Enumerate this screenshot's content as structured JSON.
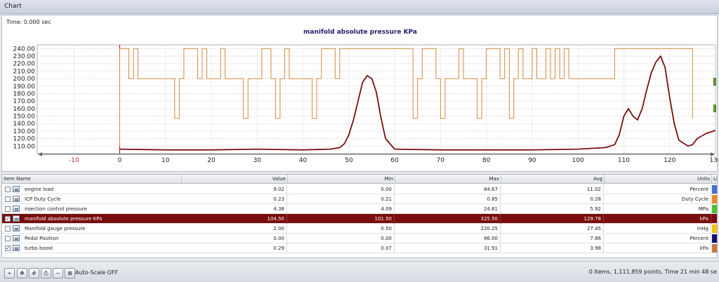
{
  "window": {
    "title": "Chart"
  },
  "chart": {
    "time_label": "Time: 0.000 sec",
    "title": "manifold absolute pressure KPa"
  },
  "chart_data": {
    "type": "line",
    "title": "manifold absolute pressure KPa",
    "xlabel": "",
    "ylabel": "",
    "xlim": [
      -18,
      130
    ],
    "ylim": [
      100,
      245
    ],
    "x_ticks": [
      -10,
      0,
      10,
      20,
      30,
      40,
      50,
      60,
      70,
      80,
      90,
      100,
      110,
      120,
      130
    ],
    "y_ticks": [
      110,
      120,
      130,
      140,
      150,
      160,
      170,
      180,
      190,
      200,
      210,
      220,
      230,
      240
    ],
    "y_tick_labels": [
      "110.00",
      "120.00",
      "130.00",
      "140.00",
      "150.00",
      "160.00",
      "170.00",
      "180.00",
      "190.00",
      "200.00",
      "210.00",
      "220.00",
      "230.00",
      "240.00"
    ],
    "grid": true,
    "series": [
      {
        "name": "manifold absolute pressure KPa",
        "color": "#7a1010",
        "x": [
          0,
          10,
          20,
          30,
          40,
          46,
          48,
          49,
          50,
          51,
          52,
          53,
          54,
          55,
          56,
          57,
          58,
          60,
          70,
          80,
          90,
          100,
          106,
          108,
          109,
          110,
          111,
          112,
          113,
          114,
          115,
          116,
          117,
          118,
          119,
          120,
          121,
          122,
          124,
          125,
          126,
          128,
          130
        ],
        "y": [
          106,
          105,
          105,
          106,
          105,
          106,
          108,
          113,
          125,
          145,
          170,
          195,
          204,
          200,
          182,
          148,
          120,
          106,
          105,
          105,
          105,
          106,
          108,
          112,
          125,
          150,
          160,
          150,
          145,
          160,
          185,
          208,
          222,
          230,
          215,
          175,
          140,
          118,
          110,
          112,
          120,
          127,
          131
        ]
      },
      {
        "name": "turbo boost",
        "color": "#d08a3c",
        "x": [
          0,
          0,
          2,
          2,
          3,
          3,
          4,
          4,
          12,
          12,
          13,
          13,
          14,
          14,
          17,
          17,
          18,
          18,
          19,
          19,
          22,
          22,
          23,
          23,
          27,
          27,
          28,
          28,
          31,
          31,
          33,
          33,
          34,
          34,
          35,
          35,
          36,
          36,
          37,
          37,
          42,
          42,
          43,
          43,
          44,
          44,
          47,
          47,
          48,
          48,
          64,
          64,
          65,
          65,
          66,
          66,
          69,
          69,
          70,
          70,
          71,
          71,
          74,
          74,
          75,
          75,
          78,
          78,
          79,
          79,
          80,
          80,
          83,
          83,
          84,
          84,
          85,
          85,
          86,
          86,
          87,
          87,
          88,
          88,
          90,
          90,
          91,
          91,
          93,
          93,
          94,
          94,
          95,
          95,
          96,
          96,
          97,
          97,
          98,
          98,
          108,
          108,
          125,
          125
        ],
        "y": [
          110,
          240,
          240,
          200,
          200,
          240,
          240,
          200,
          200,
          147,
          147,
          200,
          200,
          240,
          240,
          200,
          200,
          240,
          240,
          200,
          200,
          240,
          240,
          200,
          200,
          147,
          147,
          200,
          200,
          240,
          240,
          200,
          200,
          147,
          147,
          200,
          200,
          240,
          240,
          200,
          200,
          147,
          147,
          200,
          200,
          240,
          240,
          200,
          200,
          240,
          240,
          147,
          147,
          200,
          200,
          240,
          240,
          200,
          200,
          147,
          147,
          200,
          200,
          240,
          240,
          200,
          200,
          147,
          147,
          200,
          200,
          240,
          240,
          200,
          200,
          240,
          240,
          147,
          147,
          200,
          200,
          240,
          240,
          200,
          200,
          240,
          240,
          200,
          200,
          240,
          240,
          200,
          200,
          240,
          240,
          200,
          200,
          240,
          240,
          200,
          200,
          240,
          240,
          147
        ]
      }
    ]
  },
  "table": {
    "headers": {
      "name": "Item Name",
      "value": "Value",
      "min": "Min",
      "max": "Max",
      "avg": "Avg",
      "units": "Units",
      "line": "Line"
    },
    "rows": [
      {
        "checked": false,
        "name": "engine load",
        "value": "9.02",
        "min": "0.00",
        "max": "84.67",
        "avg": "11.02",
        "units": "Percent",
        "color": "#3f6fd9",
        "selected": false
      },
      {
        "checked": false,
        "name": "ICP Duty Cycle",
        "value": "0.23",
        "min": "0.21",
        "max": "0.85",
        "avg": "0.28",
        "units": "Duty Cycle",
        "color": "#f0861a",
        "selected": false
      },
      {
        "checked": false,
        "name": "injection control pressure",
        "value": "4.38",
        "min": "4.09",
        "max": "24.61",
        "avg": "5.92",
        "units": "MPa",
        "color": "#49c136",
        "selected": false
      },
      {
        "checked": true,
        "name": "manifold absolute pressure KPa",
        "value": "104.50",
        "min": "101.50",
        "max": "325.50",
        "avg": "129.78",
        "units": "kPa",
        "color": "#7a0c0c",
        "selected": true
      },
      {
        "checked": false,
        "name": "Manifold gauge pressure",
        "value": "2.00",
        "min": "0.50",
        "max": "220.25",
        "avg": "27.45",
        "units": "inHg",
        "color": "#f2c400",
        "selected": false
      },
      {
        "checked": false,
        "name": "Pedal Position",
        "value": "0.00",
        "min": "0.00",
        "max": "86.00",
        "avg": "7.86",
        "units": "Percent",
        "color": "#12127a",
        "selected": false
      },
      {
        "checked": true,
        "name": "turbo boost",
        "value": "0.29",
        "min": "0.07",
        "max": "31.91",
        "avg": "3.98",
        "units": "kPa",
        "color": "#c77a3a",
        "selected": false
      }
    ]
  },
  "toolbar": {
    "autoscale_label": "Auto-Scale OFF",
    "status": "0 Items, 1,111,859 points, Time 21 min 48 se"
  }
}
